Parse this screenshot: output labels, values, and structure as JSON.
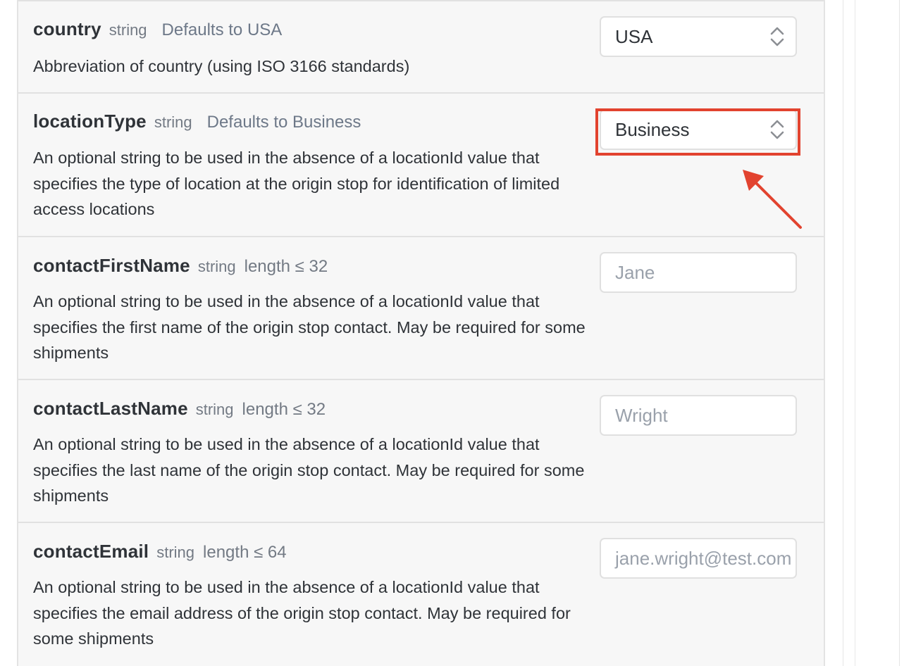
{
  "params": [
    {
      "name": "country",
      "type": "string",
      "constraint": "",
      "default": "Defaults to USA",
      "description": "Abbreviation of country (using ISO 3166 standards)",
      "field": {
        "kind": "select",
        "value": "USA",
        "icon": "chevron-updown-icon"
      }
    },
    {
      "name": "locationType",
      "type": "string",
      "constraint": "",
      "default": "Defaults to Business",
      "description": "An optional string to be used in the absence of a locationId value that specifies the type of location at the origin stop for identification of limited access locations",
      "field": {
        "kind": "select",
        "value": "Business",
        "icon": "chevron-updown-icon"
      }
    },
    {
      "name": "contactFirstName",
      "type": "string",
      "constraint": "length ≤ 32",
      "default": "",
      "description": "An optional string to be used in the absence of a locationId value that specifies the first name of the origin stop contact. May be required for some shipments",
      "field": {
        "kind": "input",
        "placeholder": "Jane"
      }
    },
    {
      "name": "contactLastName",
      "type": "string",
      "constraint": "length ≤ 32",
      "default": "",
      "description": "An optional string to be used in the absence of a locationId value that specifies the last name of the origin stop contact. May be required for some shipments",
      "field": {
        "kind": "input",
        "placeholder": "Wright"
      }
    },
    {
      "name": "contactEmail",
      "type": "string",
      "constraint": "length ≤ 64",
      "default": "",
      "description": "An optional string to be used in the absence of a locationId value that specifies the email address of the origin stop contact. May be required for some shipments",
      "field": {
        "kind": "input",
        "placeholder": "jane.wright@test.com"
      }
    }
  ],
  "annotation": {
    "highlight_color": "#e2432f",
    "target": "locationType select"
  },
  "colors": {
    "panel_bg": "#f7f7f7",
    "text": "#2f3338",
    "muted": "#737a84",
    "placeholder": "#9aa1ab"
  }
}
